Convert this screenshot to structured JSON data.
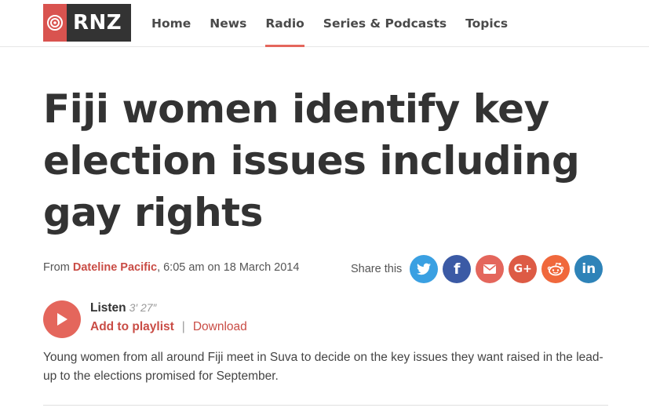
{
  "brand": {
    "name": "RNZ",
    "accent": "#e4665c",
    "logo_bg": "#333333"
  },
  "nav": {
    "items": [
      {
        "label": "Home"
      },
      {
        "label": "News"
      },
      {
        "label": "Radio",
        "active": true
      },
      {
        "label": "Series & Podcasts"
      },
      {
        "label": "Topics"
      }
    ]
  },
  "article": {
    "title": "Fiji women identify key election issues including gay rights",
    "byline": {
      "from": "From",
      "programme": "Dateline Pacific",
      "time": ", 6:05 am on 18 March 2014"
    },
    "share": {
      "label": "Share this",
      "networks": [
        {
          "name": "twitter-icon",
          "glyph": "🐦",
          "color": "#3aa0e2"
        },
        {
          "name": "facebook-icon",
          "glyph": "f",
          "color": "#3b5aa5"
        },
        {
          "name": "email-icon",
          "glyph": "✉",
          "color": "#e4665c"
        },
        {
          "name": "google-plus-icon",
          "glyph": "G+",
          "color": "#dd5b45"
        },
        {
          "name": "reddit-icon",
          "glyph": "☺",
          "color": "#f0683c"
        },
        {
          "name": "linkedin-icon",
          "glyph": "in",
          "color": "#2e83b8"
        }
      ]
    },
    "audio": {
      "listen_label": "Listen",
      "duration": "3′ 27″",
      "add_label": "Add to playlist",
      "separator": "|",
      "download_label": "Download"
    },
    "summary": "Young women from all around Fiji meet in Suva to decide on the key issues they want raised in the lead-up to the elections promised for September."
  }
}
